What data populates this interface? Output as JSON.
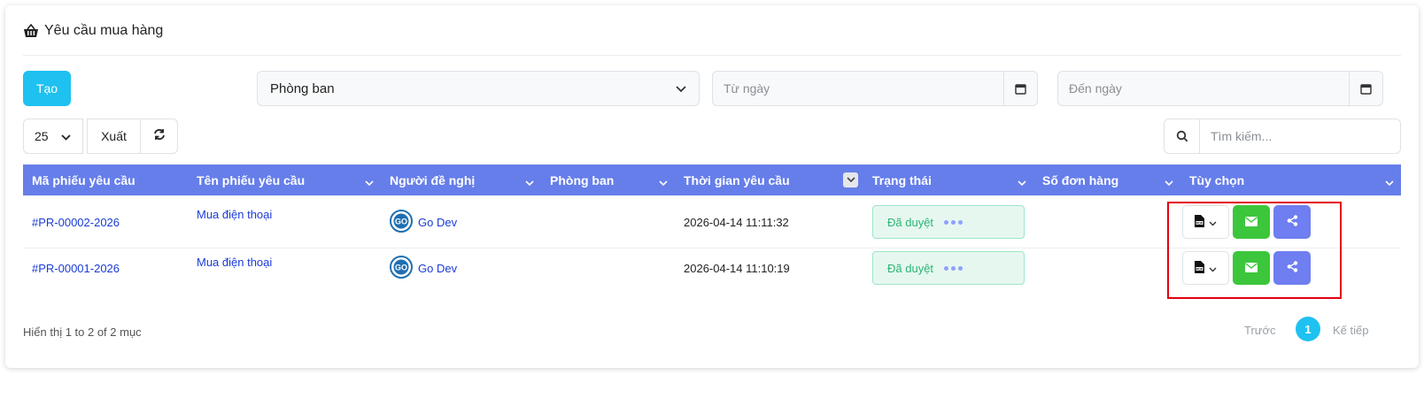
{
  "page": {
    "title": "Yêu cầu mua hàng",
    "title_icon": "basket-icon"
  },
  "toolbar": {
    "create_label": "Tạo",
    "department_select": {
      "value": "Phòng ban"
    },
    "from_date": {
      "placeholder": "Từ ngày",
      "icon": "calendar-icon"
    },
    "to_date": {
      "placeholder": "Đến ngày",
      "icon": "calendar-icon"
    },
    "page_size": "25",
    "export_label": "Xuất",
    "refresh_icon": "refresh-icon",
    "search": {
      "placeholder": "Tìm kiếm...",
      "icon": "search-icon"
    }
  },
  "table": {
    "columns": [
      {
        "label": "Mã phiếu yêu cầu"
      },
      {
        "label": "Tên phiếu yêu cầu"
      },
      {
        "label": "Người đề nghị"
      },
      {
        "label": "Phòng ban"
      },
      {
        "label": "Thời gian yêu cầu"
      },
      {
        "label": "Trạng thái"
      },
      {
        "label": "Số đơn hàng"
      },
      {
        "label": "Tùy chọn"
      }
    ],
    "rows": [
      {
        "code": "#PR-00002-2026",
        "name": "Mua điện thoại",
        "requester": "Go Dev",
        "department": "",
        "time": "2026-04-14 11:11:32",
        "status": "Đã duyệt",
        "order_no": ""
      },
      {
        "code": "#PR-00001-2026",
        "name": "Mua điện thoại",
        "requester": "Go Dev",
        "department": "",
        "time": "2026-04-14 11:10:19",
        "status": "Đã duyệt",
        "order_no": ""
      }
    ]
  },
  "footer": {
    "info": "Hiển thị 1 to 2 of 2 mục",
    "prev_label": "Trước",
    "current_page": "1",
    "next_label": "Kế tiếp"
  },
  "colors": {
    "primary": "#1ec1f0",
    "header_bg": "#667eea",
    "approved_text": "#2bb673",
    "approved_bg": "#e6f7f0",
    "email_btn": "#3cc63c",
    "share_btn": "#6f7ef0",
    "highlight_box": "#e3000f"
  }
}
